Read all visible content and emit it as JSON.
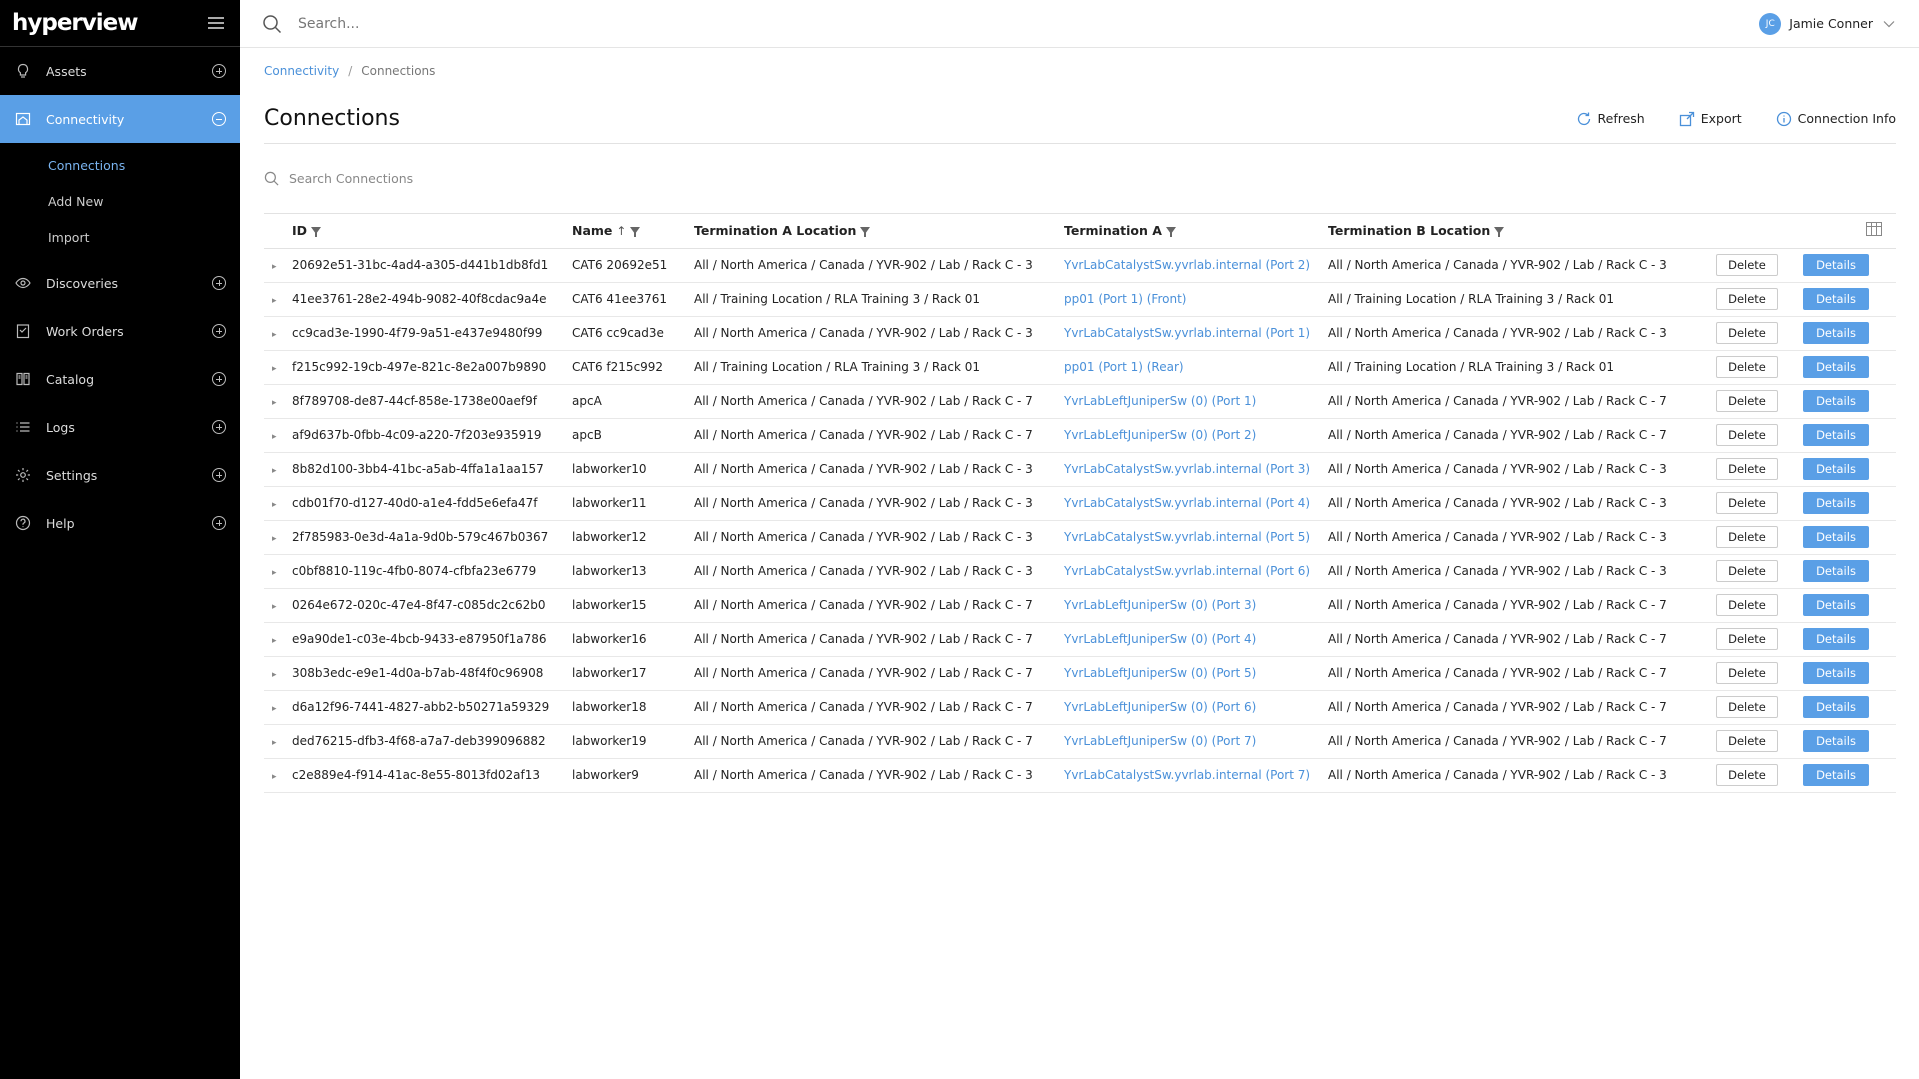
{
  "app": {
    "logo_text": "hyperview"
  },
  "sidebar": {
    "items": [
      {
        "label": "Assets",
        "icon": "bulb-icon"
      },
      {
        "label": "Connectivity",
        "icon": "building-icon",
        "active": true,
        "subitems": [
          {
            "label": "Connections",
            "active": true
          },
          {
            "label": "Add New"
          },
          {
            "label": "Import"
          }
        ]
      },
      {
        "label": "Discoveries",
        "icon": "eye-icon"
      },
      {
        "label": "Work Orders",
        "icon": "clipboard-icon"
      },
      {
        "label": "Catalog",
        "icon": "book-icon"
      },
      {
        "label": "Logs",
        "icon": "list-icon"
      },
      {
        "label": "Settings",
        "icon": "gear-icon"
      },
      {
        "label": "Help",
        "icon": "help-icon"
      }
    ]
  },
  "header": {
    "search_placeholder": "Search...",
    "user": {
      "initials": "JC",
      "name": "Jamie Conner"
    }
  },
  "breadcrumb": {
    "parent": "Connectivity",
    "separator": "/",
    "current": "Connections"
  },
  "page": {
    "title": "Connections",
    "actions": {
      "refresh": "Refresh",
      "export": "Export",
      "info": "Connection Info"
    },
    "table_search_placeholder": "Search Connections"
  },
  "colors": {
    "accent": "#5a9fe6",
    "link": "#4a90d9",
    "sidebar_bg": "#000000"
  },
  "table": {
    "headers": {
      "id": "ID",
      "name": "Name",
      "term_a_loc": "Termination A Location",
      "term_a": "Termination A",
      "term_b_loc": "Termination B Location"
    },
    "delete_label": "Delete",
    "details_label": "Details",
    "rows": [
      {
        "id": "20692e51-31bc-4ad4-a305-d441b1db8fd1",
        "name": "CAT6 20692e51",
        "a_loc": "All / North America / Canada / YVR-902 / Lab / Rack C - 3",
        "a": "YvrLabCatalystSw.yvrlab.internal (Port 2)",
        "b_loc": "All / North America / Canada / YVR-902 / Lab / Rack C - 3"
      },
      {
        "id": "41ee3761-28e2-494b-9082-40f8cdac9a4e",
        "name": "CAT6 41ee3761",
        "a_loc": "All / Training Location / RLA Training 3 / Rack 01",
        "a": "pp01 (Port 1) (Front)",
        "b_loc": "All / Training Location / RLA Training 3 / Rack 01"
      },
      {
        "id": "cc9cad3e-1990-4f79-9a51-e437e9480f99",
        "name": "CAT6 cc9cad3e",
        "a_loc": "All / North America / Canada / YVR-902 / Lab / Rack C - 3",
        "a": "YvrLabCatalystSw.yvrlab.internal (Port 1)",
        "b_loc": "All / North America / Canada / YVR-902 / Lab / Rack C - 3"
      },
      {
        "id": "f215c992-19cb-497e-821c-8e2a007b9890",
        "name": "CAT6 f215c992",
        "a_loc": "All / Training Location / RLA Training 3 / Rack 01",
        "a": "pp01 (Port 1) (Rear)",
        "b_loc": "All / Training Location / RLA Training 3 / Rack 01"
      },
      {
        "id": "8f789708-de87-44cf-858e-1738e00aef9f",
        "name": "apcA",
        "a_loc": "All / North America / Canada / YVR-902 / Lab / Rack C - 7",
        "a": "YvrLabLeftJuniperSw (0) (Port 1)",
        "b_loc": "All / North America / Canada / YVR-902 / Lab / Rack C - 7"
      },
      {
        "id": "af9d637b-0fbb-4c09-a220-7f203e935919",
        "name": "apcB",
        "a_loc": "All / North America / Canada / YVR-902 / Lab / Rack C - 7",
        "a": "YvrLabLeftJuniperSw (0) (Port 2)",
        "b_loc": "All / North America / Canada / YVR-902 / Lab / Rack C - 7"
      },
      {
        "id": "8b82d100-3bb4-41bc-a5ab-4ffa1a1aa157",
        "name": "labworker10",
        "a_loc": "All / North America / Canada / YVR-902 / Lab / Rack C - 3",
        "a": "YvrLabCatalystSw.yvrlab.internal (Port 3)",
        "b_loc": "All / North America / Canada / YVR-902 / Lab / Rack C - 3"
      },
      {
        "id": "cdb01f70-d127-40d0-a1e4-fdd5e6efa47f",
        "name": "labworker11",
        "a_loc": "All / North America / Canada / YVR-902 / Lab / Rack C - 3",
        "a": "YvrLabCatalystSw.yvrlab.internal (Port 4)",
        "b_loc": "All / North America / Canada / YVR-902 / Lab / Rack C - 3"
      },
      {
        "id": "2f785983-0e3d-4a1a-9d0b-579c467b0367",
        "name": "labworker12",
        "a_loc": "All / North America / Canada / YVR-902 / Lab / Rack C - 3",
        "a": "YvrLabCatalystSw.yvrlab.internal (Port 5)",
        "b_loc": "All / North America / Canada / YVR-902 / Lab / Rack C - 3"
      },
      {
        "id": "c0bf8810-119c-4fb0-8074-cfbfa23e6779",
        "name": "labworker13",
        "a_loc": "All / North America / Canada / YVR-902 / Lab / Rack C - 3",
        "a": "YvrLabCatalystSw.yvrlab.internal (Port 6)",
        "b_loc": "All / North America / Canada / YVR-902 / Lab / Rack C - 3"
      },
      {
        "id": "0264e672-020c-47e4-8f47-c085dc2c62b0",
        "name": "labworker15",
        "a_loc": "All / North America / Canada / YVR-902 / Lab / Rack C - 7",
        "a": "YvrLabLeftJuniperSw (0) (Port 3)",
        "b_loc": "All / North America / Canada / YVR-902 / Lab / Rack C - 7"
      },
      {
        "id": "e9a90de1-c03e-4bcb-9433-e87950f1a786",
        "name": "labworker16",
        "a_loc": "All / North America / Canada / YVR-902 / Lab / Rack C - 7",
        "a": "YvrLabLeftJuniperSw (0) (Port 4)",
        "b_loc": "All / North America / Canada / YVR-902 / Lab / Rack C - 7"
      },
      {
        "id": "308b3edc-e9e1-4d0a-b7ab-48f4f0c96908",
        "name": "labworker17",
        "a_loc": "All / North America / Canada / YVR-902 / Lab / Rack C - 7",
        "a": "YvrLabLeftJuniperSw (0) (Port 5)",
        "b_loc": "All / North America / Canada / YVR-902 / Lab / Rack C - 7"
      },
      {
        "id": "d6a12f96-7441-4827-abb2-b50271a59329",
        "name": "labworker18",
        "a_loc": "All / North America / Canada / YVR-902 / Lab / Rack C - 7",
        "a": "YvrLabLeftJuniperSw (0) (Port 6)",
        "b_loc": "All / North America / Canada / YVR-902 / Lab / Rack C - 7"
      },
      {
        "id": "ded76215-dfb3-4f68-a7a7-deb399096882",
        "name": "labworker19",
        "a_loc": "All / North America / Canada / YVR-902 / Lab / Rack C - 7",
        "a": "YvrLabLeftJuniperSw (0) (Port 7)",
        "b_loc": "All / North America / Canada / YVR-902 / Lab / Rack C - 7"
      },
      {
        "id": "c2e889e4-f914-41ac-8e55-8013fd02af13",
        "name": "labworker9",
        "a_loc": "All / North America / Canada / YVR-902 / Lab / Rack C - 3",
        "a": "YvrLabCatalystSw.yvrlab.internal (Port 7)",
        "b_loc": "All / North America / Canada / YVR-902 / Lab / Rack C - 3"
      }
    ]
  }
}
